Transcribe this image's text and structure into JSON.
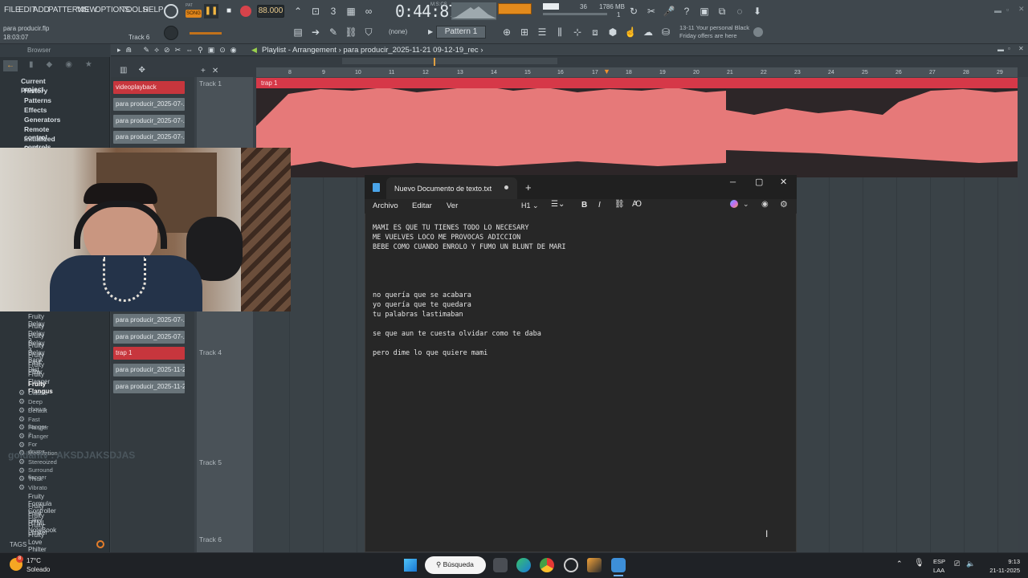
{
  "menu": {
    "items": [
      "FILE",
      "EDIT",
      "ADD",
      "PATTERNS",
      "VIEW",
      "OPTIONS",
      "TOOLS",
      "HELP"
    ],
    "song_label": "SONG",
    "pat_label": "PAT",
    "tempo": "88.000",
    "clock": "0:44:87",
    "clock_unit": "M:S:CS",
    "cpu_val": "36",
    "ram": "1786 MB",
    "ram_sub": "1",
    "none_label": "(none)",
    "pattern": "Pattern 1",
    "promo_line1": "13-11  Your personal Black",
    "promo_line2": "Friday offers are here"
  },
  "project": {
    "file": "para producir.flp",
    "time": "18:03:07",
    "track": "Track 6"
  },
  "browser": {
    "title": "Browser",
    "tree": [
      "Current project",
      "History",
      "Patterns",
      "Effects",
      "Generators",
      "Remote control",
      "Initialized controls",
      "Project data"
    ],
    "plugins_top": [
      "Fruity Delay",
      "Fruity Delay 2",
      "Fruity Delay 3",
      "Fruity Delay Bank",
      "Fruity Fast Dist",
      "Fruity Filter",
      "Fruity Flanger",
      "Fruity Flangus"
    ],
    "presets": [
      "Classic",
      "Deep chorus",
      "Default",
      "Fast flanger",
      "Flanger 2",
      "Flanger",
      "For drums",
      "Modulation",
      "Stereoized",
      "Surround flanger",
      "Thick",
      "Vibrato"
    ],
    "plugins_bottom": [
      "Fruity Formula Controller",
      "Fruity Free Filter",
      "Fruity HTML NoteBook",
      "Fruity Limiter",
      "Fruity Love Philter"
    ],
    "tags": "TAGS"
  },
  "playlist": {
    "title": "Playlist - Arrangement",
    "subtitle": "para producir_2025-11-21 09-12-19_rec",
    "clips_top": [
      {
        "label": "videoplayback",
        "red": true
      },
      {
        "label": "para producir_2025-07-...",
        "red": false
      },
      {
        "label": "para producir_2025-07-...",
        "red": false
      },
      {
        "label": "para producir_2025-07-...",
        "red": false
      }
    ],
    "clips_bottom": [
      {
        "label": "para producir_2025-07-...",
        "red": false
      },
      {
        "label": "para producir_2025-07-...",
        "red": false
      },
      {
        "label": "trap 1",
        "red": true
      },
      {
        "label": "para producir_2025-11-2...",
        "red": false
      },
      {
        "label": "para producir_2025-11-2...",
        "red": false
      }
    ],
    "tracks": [
      "Track 1",
      "Track 4",
      "Track 5",
      "Track 6"
    ],
    "ruler": [
      "8",
      "9",
      "10",
      "11",
      "12",
      "13",
      "14",
      "15",
      "16",
      "17",
      "18",
      "19",
      "20",
      "21",
      "22",
      "23",
      "24",
      "25",
      "26",
      "27",
      "28",
      "29"
    ],
    "audio_clip": "trap 1"
  },
  "watermark": "goldantv : AKSDJAKSDJAS",
  "notepad": {
    "tab_title": "Nuevo Documento de texto.txt",
    "menu": [
      "Archivo",
      "Editar",
      "Ver"
    ],
    "heading": "H1",
    "body": "MAMI ES QUE TU TIENES TODO LO NECESARY\nME VUELVES LOCO ME PROVOCAS ADICCION\nBEBE COMO CUANDO ENROLO Y FUMO UN BLUNT DE MARI\n\n\n\n\nno quería que se acabara\nyo quería que te quedara\ntu palabras lastimaban\n\nse que aun te cuesta olvidar como te daba\n\npero dime lo que quiere mami"
  },
  "taskbar": {
    "temp": "17°C",
    "weather": "Soleado",
    "search": "Búsqueda",
    "lang1": "ESP",
    "lang2": "LAA",
    "time": "9:13",
    "date": "21-11-2025",
    "badge": "8"
  }
}
